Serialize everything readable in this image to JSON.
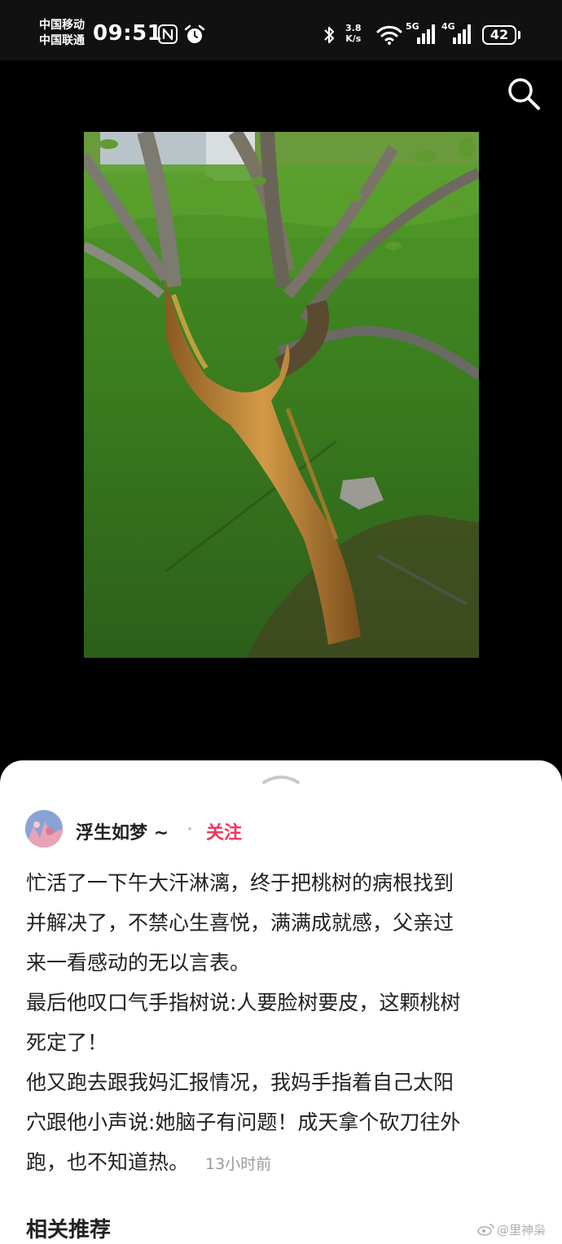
{
  "status_bar": {
    "carrier_1": "中国移动",
    "carrier_2": "中国联通",
    "time": "09:51",
    "net_speed_value": "3.8",
    "net_speed_unit": "K/s",
    "network_1": "5G",
    "network_2": "4G",
    "battery": "42",
    "icons": [
      "nfc-icon",
      "alarm-icon",
      "bluetooth-icon",
      "wifi-icon",
      "signal-5g-icon",
      "signal-4g-icon",
      "battery-icon"
    ]
  },
  "toolbar": {
    "icons": [
      "search-icon"
    ]
  },
  "post": {
    "author": "浮生如梦 ~",
    "follow_label": "关注",
    "lines": [
      "忙活了一下午大汗淋漓，终于把桃树的病根找到",
      "并解决了，不禁心生喜悦，满满成就感，父亲过",
      "来一看感动的无以言表。",
      "最后他叹口气手指树说:人要脸树要皮，这颗桃树",
      "死定了！",
      "他又跑去跟我妈汇报情况，我妈手指着自己太阳",
      "穴跟他小声说:她脑子有问题！成天拿个砍刀往外",
      "跑，也不知道热。"
    ],
    "timestamp": "13小时前"
  },
  "related": {
    "heading": "相关推荐"
  },
  "watermark": {
    "text": "@里神枭"
  },
  "colors": {
    "accent": "#f0375c",
    "text": "#222222",
    "muted": "#9a9a9a",
    "background": "#000000"
  }
}
